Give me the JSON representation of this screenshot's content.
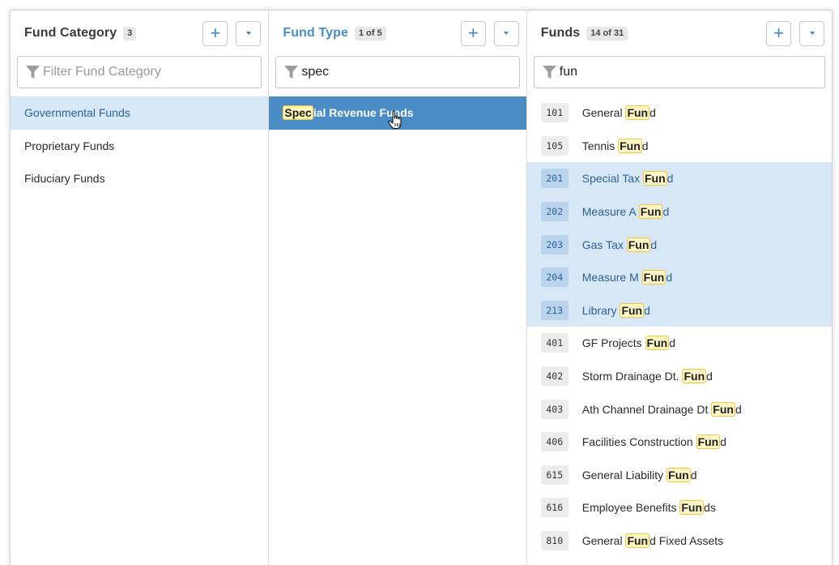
{
  "columns": [
    {
      "title": "Fund Category",
      "badge": "3",
      "filter": {
        "value": "",
        "placeholder": "Filter Fund Category"
      },
      "items": [
        {
          "label": "Governmental Funds",
          "selected": true
        },
        {
          "label": "Proprietary Funds",
          "selected": false
        },
        {
          "label": "Fiduciary Funds",
          "selected": false
        }
      ]
    },
    {
      "title": "Fund Type",
      "badge": "1 of 5",
      "filter": {
        "value": "spec",
        "placeholder": ""
      },
      "items": [
        {
          "match": "Spec",
          "rest": "ial Revenue Funds",
          "selected": true
        }
      ]
    },
    {
      "title": "Funds",
      "badge": "14 of 31",
      "filter": {
        "value": "fun",
        "placeholder": ""
      },
      "items": [
        {
          "code": "101",
          "pre": "General ",
          "match": "Fun",
          "post": "d",
          "selected": false
        },
        {
          "code": "105",
          "pre": "Tennis ",
          "match": "Fun",
          "post": "d",
          "selected": false
        },
        {
          "code": "201",
          "pre": "Special Tax ",
          "match": "Fun",
          "post": "d",
          "selected": true
        },
        {
          "code": "202",
          "pre": "Measure A ",
          "match": "Fun",
          "post": "d",
          "selected": true
        },
        {
          "code": "203",
          "pre": "Gas Tax ",
          "match": "Fun",
          "post": "d",
          "selected": true
        },
        {
          "code": "204",
          "pre": "Measure M ",
          "match": "Fun",
          "post": "d",
          "selected": true
        },
        {
          "code": "213",
          "pre": "Library ",
          "match": "Fun",
          "post": "d",
          "selected": true
        },
        {
          "code": "401",
          "pre": "GF Projects ",
          "match": "Fun",
          "post": "d",
          "selected": false
        },
        {
          "code": "402",
          "pre": "Storm Drainage Dt. ",
          "match": "Fun",
          "post": "d",
          "selected": false
        },
        {
          "code": "403",
          "pre": "Ath Channel Drainage Dt ",
          "match": "Fun",
          "post": "d",
          "selected": false
        },
        {
          "code": "406",
          "pre": "Facilities Construction ",
          "match": "Fun",
          "post": "d",
          "selected": false
        },
        {
          "code": "615",
          "pre": "General Liability ",
          "match": "Fun",
          "post": "d",
          "selected": false
        },
        {
          "code": "616",
          "pre": "Employee Benefits ",
          "match": "Fun",
          "post": "ds",
          "selected": false
        },
        {
          "code": "810",
          "pre": "General ",
          "match": "Fun",
          "post": "d Fixed Assets",
          "selected": false
        }
      ]
    }
  ],
  "icons": {
    "add": "plus-icon",
    "menu": "caret-down-icon",
    "filter": "funnel-icon",
    "cursor": "hand-pointer-icon"
  },
  "colors": {
    "accent": "#4a8cc6",
    "selected_light": "#d7e7f5",
    "highlight": "#fff5c7",
    "highlight_border": "#f0c83a"
  }
}
